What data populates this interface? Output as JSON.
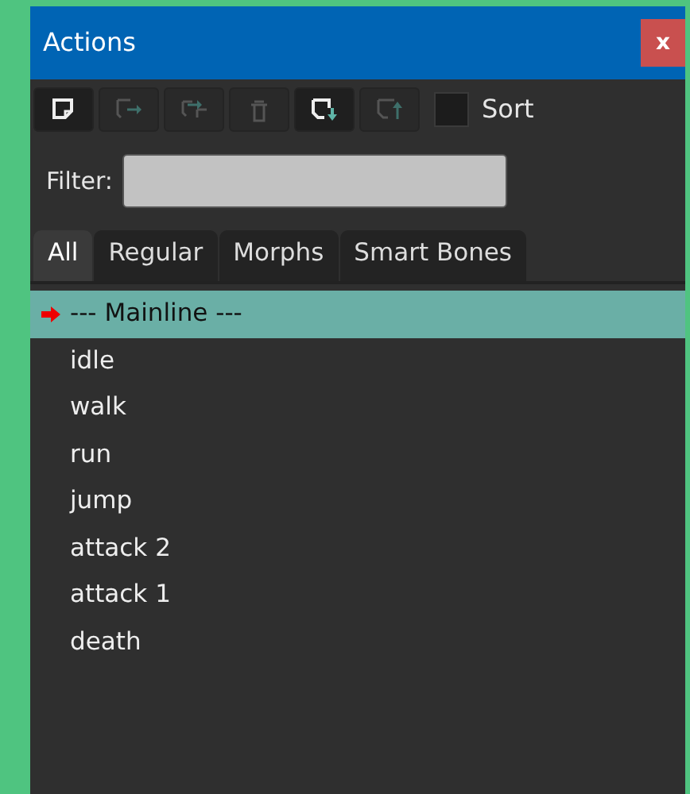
{
  "window": {
    "title": "Actions",
    "close": "x"
  },
  "toolbar": [
    {
      "kind": "new",
      "disabled": false
    },
    {
      "kind": "move",
      "disabled": true
    },
    {
      "kind": "split",
      "disabled": true
    },
    {
      "kind": "delete",
      "disabled": true
    },
    {
      "kind": "import",
      "disabled": false
    },
    {
      "kind": "export",
      "disabled": true
    }
  ],
  "sort": {
    "label": "Sort",
    "checked": false
  },
  "filter": {
    "label": "Filter:"
  },
  "tabs": [
    {
      "label": "All",
      "selected": true
    },
    {
      "label": "Regular",
      "selected": false
    },
    {
      "label": "Morphs",
      "selected": false
    },
    {
      "label": "Smart Bones",
      "selected": false
    }
  ],
  "actions": [
    {
      "label": "--- Mainline ---",
      "selected": true,
      "current": true
    },
    {
      "label": "idle",
      "selected": false,
      "current": false
    },
    {
      "label": "walk",
      "selected": false,
      "current": false
    },
    {
      "label": "run",
      "selected": false,
      "current": false
    },
    {
      "label": "jump",
      "selected": false,
      "current": false
    },
    {
      "label": "attack 2",
      "selected": false,
      "current": false
    },
    {
      "label": "attack 1",
      "selected": false,
      "current": false
    },
    {
      "label": "death",
      "selected": false,
      "current": false
    }
  ]
}
